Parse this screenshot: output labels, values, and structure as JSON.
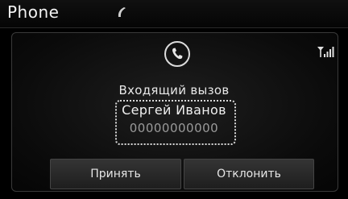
{
  "header": {
    "title": "Phone",
    "icon": "handset-icon"
  },
  "call": {
    "icon": "phone-call-icon",
    "signal_icon": "signal-strength-icon",
    "status": "Входящий вызов",
    "caller_name": "Сергей Иванов",
    "caller_number": "00000000000"
  },
  "actions": {
    "accept_label": "Принять",
    "decline_label": "Отклонить"
  },
  "colors": {
    "background": "#000000",
    "text": "#e6e6e6",
    "secondary_text": "#9a9a9a"
  }
}
